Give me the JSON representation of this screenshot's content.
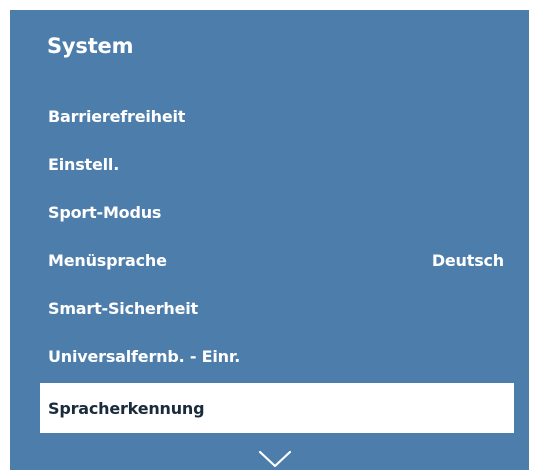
{
  "menu": {
    "title": "System",
    "items": [
      {
        "label": "Barrierefreiheit",
        "value": ""
      },
      {
        "label": "Einstell.",
        "value": ""
      },
      {
        "label": "Sport-Modus",
        "value": ""
      },
      {
        "label": "Menüsprache",
        "value": "Deutsch"
      },
      {
        "label": "Smart-Sicherheit",
        "value": ""
      },
      {
        "label": "Universalfernb. - Einr.",
        "value": ""
      },
      {
        "label": "Spracherkennung",
        "value": "",
        "selected": true
      }
    ],
    "scroll_icon": "chevron-down-icon"
  },
  "colors": {
    "panel_background": "#4c7dab",
    "text": "#ffffff",
    "selected_background": "#ffffff",
    "selected_text": "#1a2b3c"
  }
}
